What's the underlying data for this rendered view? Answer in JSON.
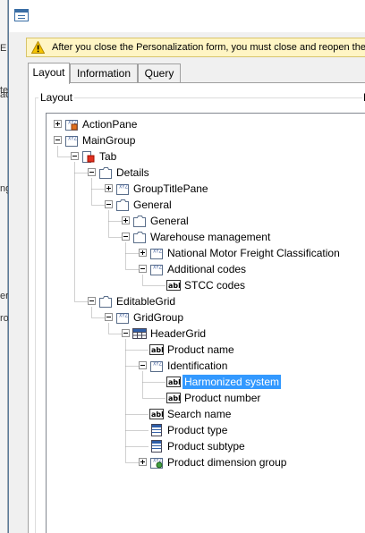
{
  "infobar": {
    "icon": "warning-icon",
    "message": "After you close the Personalization form, you must close and reopen the Pro"
  },
  "tabs": [
    {
      "label": "Layout",
      "active": true
    },
    {
      "label": "Information",
      "active": false
    },
    {
      "label": "Query",
      "active": false
    }
  ],
  "layout_group": {
    "label": "Layout",
    "right_label": "P"
  },
  "background": {
    "glyphs": [
      "E",
      "te",
      "ac",
      "ng",
      "er",
      "ro"
    ]
  },
  "tree": [
    {
      "label": "ActionPane",
      "icon": "action-pane-icon",
      "expander": "plus"
    },
    {
      "label": "MainGroup",
      "icon": "group-icon",
      "expander": "minus"
    },
    {
      "label": "Tab",
      "icon": "tab-icon",
      "expander": "minus"
    },
    {
      "label": "Details",
      "icon": "tab-page-icon",
      "expander": "minus"
    },
    {
      "label": "GroupTitlePane",
      "icon": "group-icon",
      "expander": "plus"
    },
    {
      "label": "General",
      "icon": "tab-page-icon",
      "expander": "minus"
    },
    {
      "label": "General",
      "icon": "tab-page-icon",
      "expander": "plus"
    },
    {
      "label": "Warehouse management",
      "icon": "tab-page-icon",
      "expander": "minus"
    },
    {
      "label": "National Motor Freight Classification",
      "icon": "group-icon",
      "expander": "plus"
    },
    {
      "label": "Additional codes",
      "icon": "group-icon",
      "expander": "minus"
    },
    {
      "label": "STCC codes",
      "icon": "string-field-icon",
      "expander": "none"
    },
    {
      "label": "EditableGrid",
      "icon": "tab-page-icon",
      "expander": "minus"
    },
    {
      "label": "GridGroup",
      "icon": "group-icon",
      "expander": "minus"
    },
    {
      "label": "HeaderGrid",
      "icon": "grid-icon",
      "expander": "minus"
    },
    {
      "label": "Product name",
      "icon": "string-field-icon",
      "expander": "none"
    },
    {
      "label": "Identification",
      "icon": "group-icon",
      "expander": "minus"
    },
    {
      "label": "Harmonized system",
      "icon": "string-field-icon",
      "expander": "none",
      "selected": true
    },
    {
      "label": "Product number",
      "icon": "string-field-icon",
      "expander": "none"
    },
    {
      "label": "Search name",
      "icon": "string-field-icon",
      "expander": "none"
    },
    {
      "label": "Product type",
      "icon": "enum-field-icon",
      "expander": "none"
    },
    {
      "label": "Product subtype",
      "icon": "enum-field-icon",
      "expander": "none"
    },
    {
      "label": "Product dimension group",
      "icon": "reference-group-icon",
      "expander": "plus"
    }
  ],
  "colors": {
    "selection": "#3399ff",
    "infobar_bg": "#fff5c4"
  }
}
